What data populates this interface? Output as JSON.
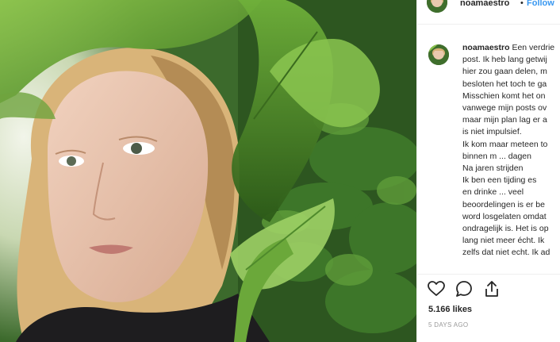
{
  "post": {
    "username": "noamaestro",
    "separator": "•",
    "follow_label": "Follow",
    "photo_icon": "portrait-through-leaves-photo"
  },
  "caption": {
    "username": "noamaestro",
    "lines": [
      "Een verdrie",
      "post. Ik heb lang getwij",
      "hier zou gaan delen, m",
      "besloten het toch te ga",
      "Misschien komt het on",
      "vanwege mijn posts ov",
      "maar mijn plan lag er a",
      "is niet impulsief.",
      "Ik kom maar meteen to",
      "binnen m   ...  dagen",
      "Na jaren strijden   ",
      "Ik ben   een tijding es",
      "en drinke   ... veel",
      "beoordelingen is er be",
      "word losgelaten omdat",
      "ondragelijk is. Het is op",
      "lang niet meer écht. Ik",
      "zelfs dat niet echt. Ik ad"
    ]
  },
  "actions": {
    "like_icon": "heart-icon",
    "comment_icon": "comment-icon",
    "share_icon": "share-icon",
    "likes_text": "5.166 likes",
    "time_text": "5 DAYS AGO"
  },
  "colors": {
    "link": "#3897f0",
    "text": "#262626",
    "muted": "#999999",
    "border": "#efefef"
  }
}
